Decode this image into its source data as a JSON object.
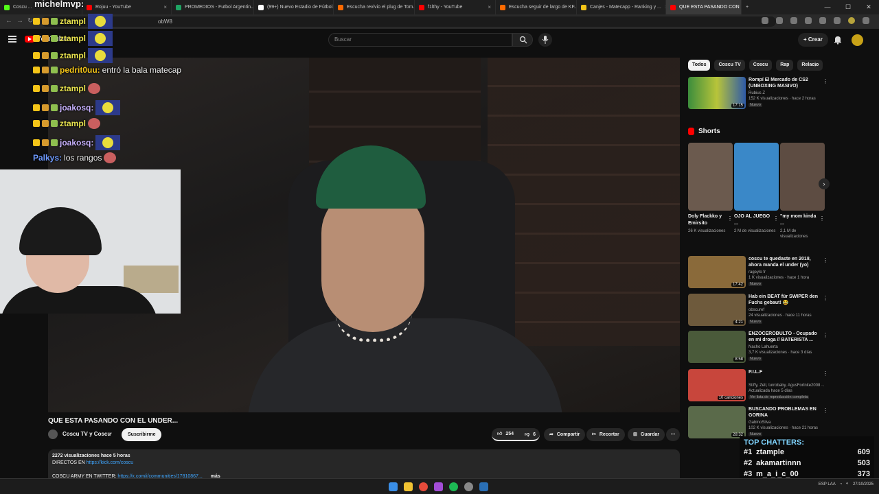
{
  "browser": {
    "tabs": [
      {
        "label": "Coscu ...",
        "color": "#53fc18"
      },
      {
        "label": "Rojuu - YouTube",
        "color": "#ff0000"
      },
      {
        "label": "PROMEDIOS - Futbol Argentin...",
        "color": "#1fa463"
      },
      {
        "label": "(99+) Nuevo Estadio de Fútbol...",
        "color": "#ffffff"
      },
      {
        "label": "Escucha revivio el plug de Tom...",
        "color": "#ff6a00"
      },
      {
        "label": "f1lthy - YouTube",
        "color": "#ff0000"
      },
      {
        "label": "Escucha seguir de largo de KF...",
        "color": "#ff6a00"
      },
      {
        "label": "Canjes - Matecapp - Ranking y ...",
        "color": "#f5c518"
      },
      {
        "label": "QUE ESTA PASANDO CON E...",
        "color": "#ff0000"
      }
    ],
    "url": "obW8"
  },
  "youtube": {
    "logo": "YouTube",
    "search_placeholder": "Buscar",
    "create_label": "Crear"
  },
  "chat": {
    "top_user": "michelmvp:",
    "lines": [
      {
        "user": "ztampl",
        "text": "",
        "emote": "big",
        "color": "#e9e34f"
      },
      {
        "user": "ztampl",
        "text": "",
        "emote": "big",
        "color": "#e9e34f"
      },
      {
        "user": "ztampl",
        "text": "",
        "emote": "big",
        "color": "#e9e34f"
      },
      {
        "user": "pedrit0uu:",
        "text": "entró la bala matecap",
        "emote": "none",
        "color": "#f5c518"
      },
      {
        "user": "ztampl",
        "text": "",
        "emote": "small",
        "color": "#e9e34f"
      },
      {
        "user": "joakosq:",
        "text": "",
        "emote": "big",
        "color": "#c9b3ff"
      },
      {
        "user": "ztampl",
        "text": "",
        "emote": "small",
        "color": "#e9e34f"
      },
      {
        "user": "joakosq:",
        "text": "",
        "emote": "big",
        "color": "#c9b3ff"
      },
      {
        "user": "Palkys:",
        "text": "los rangos",
        "emote": "small",
        "color": "#6f9bff"
      }
    ]
  },
  "video": {
    "title": "QUE ESTA PASANDO CON EL UNDER...",
    "channel": "Coscu TV y Coscu",
    "subscribe_label": "Suscribirme",
    "likes": "254",
    "dislikes": "6",
    "share_label": "Compartir",
    "clip_label": "Recortar",
    "save_label": "Guardar",
    "description": {
      "stats": "2272 visualizaciones  hace 5 horas",
      "line1_prefix": "DIRECTOS EN ",
      "line1_link": "https://kick.com/coscu",
      "line2_prefix": "COSCU ARMY EN TWITTER: ",
      "line2_link": "https://x.com/i/communities/17810867...",
      "more": "más"
    }
  },
  "sidebar": {
    "chips": [
      "Todos",
      "Coscu TV",
      "Coscu",
      "Rap",
      "Relacio"
    ],
    "top_rec": {
      "title": "Rompí El Mercado de CS2 (UNBOXING MASIVO)",
      "channel": "Rubius Z",
      "meta": "152 K visualizaciones · hace 2 horas",
      "badge": "Nuevo",
      "duration": "17:15"
    },
    "shorts_heading": "Shorts",
    "shorts": [
      {
        "title": "Doly Flackko y Emirsito",
        "views": "26 K visualizaciones",
        "color": "#6b5a4e"
      },
      {
        "title": "OJO AL JUEGO ...",
        "views": "2 M de visualizaciones",
        "color": "#3a88c8"
      },
      {
        "title": "\"my mom kinda ...",
        "views": "2,1 M de visualizaciones",
        "color": "#5d4c42"
      }
    ],
    "recs": [
      {
        "title": "coscu te quedaste en 2018, ahora manda el under (yo)",
        "channel": "rageylo fr",
        "meta": "1 K visualizaciones · hace 1 hora",
        "badge": "Nuevo",
        "duration": "17:42",
        "color": "#8a6a3a"
      },
      {
        "title": "Hab ein BEAT für SWIPER den Fuchs gebaut! 😂",
        "channel": "obscuref",
        "meta": "24 visualizaciones · hace 11 horas",
        "badge": "Nuevo",
        "duration": "4:21",
        "color": "#6e5a3c"
      },
      {
        "title": "ENZOCEROBULTO - Ocupado en mi droga // BATERISTA ...",
        "channel": "Nacho Lahuerta",
        "meta": "3,7 K visualizaciones · hace 3 días",
        "badge": "Nuevo",
        "duration": "8:58",
        "color": "#4a5a3a"
      },
      {
        "title": "P.I.L.F",
        "channel": "Stiffy, Zell, turrobaby, AgusFortnite2008 · A",
        "meta": "Actualizada hace 5 días",
        "badge": "Ver lista de reproducción completa",
        "duration": "10 canciones",
        "color": "#c8463c"
      },
      {
        "title": "BUSCANDO PROBLEMAS EN GORINA",
        "channel": "GabinoSilva",
        "meta": "102 K visualizaciones · hace 21 horas",
        "badge": "Nuevo",
        "duration": "28:32",
        "color": "#5a6a4a"
      }
    ]
  },
  "top_chatters": {
    "title": "TOP CHATTERS:",
    "rows": [
      {
        "rank": "#1",
        "name": "ztample",
        "count": "609"
      },
      {
        "rank": "#2",
        "name": "akamartinnn",
        "count": "503"
      },
      {
        "rank": "#3",
        "name": "m_a_i_c_00",
        "count": "373"
      }
    ]
  },
  "taskbar": {
    "lang": "ESP LAA",
    "date": "27/10/2025"
  }
}
